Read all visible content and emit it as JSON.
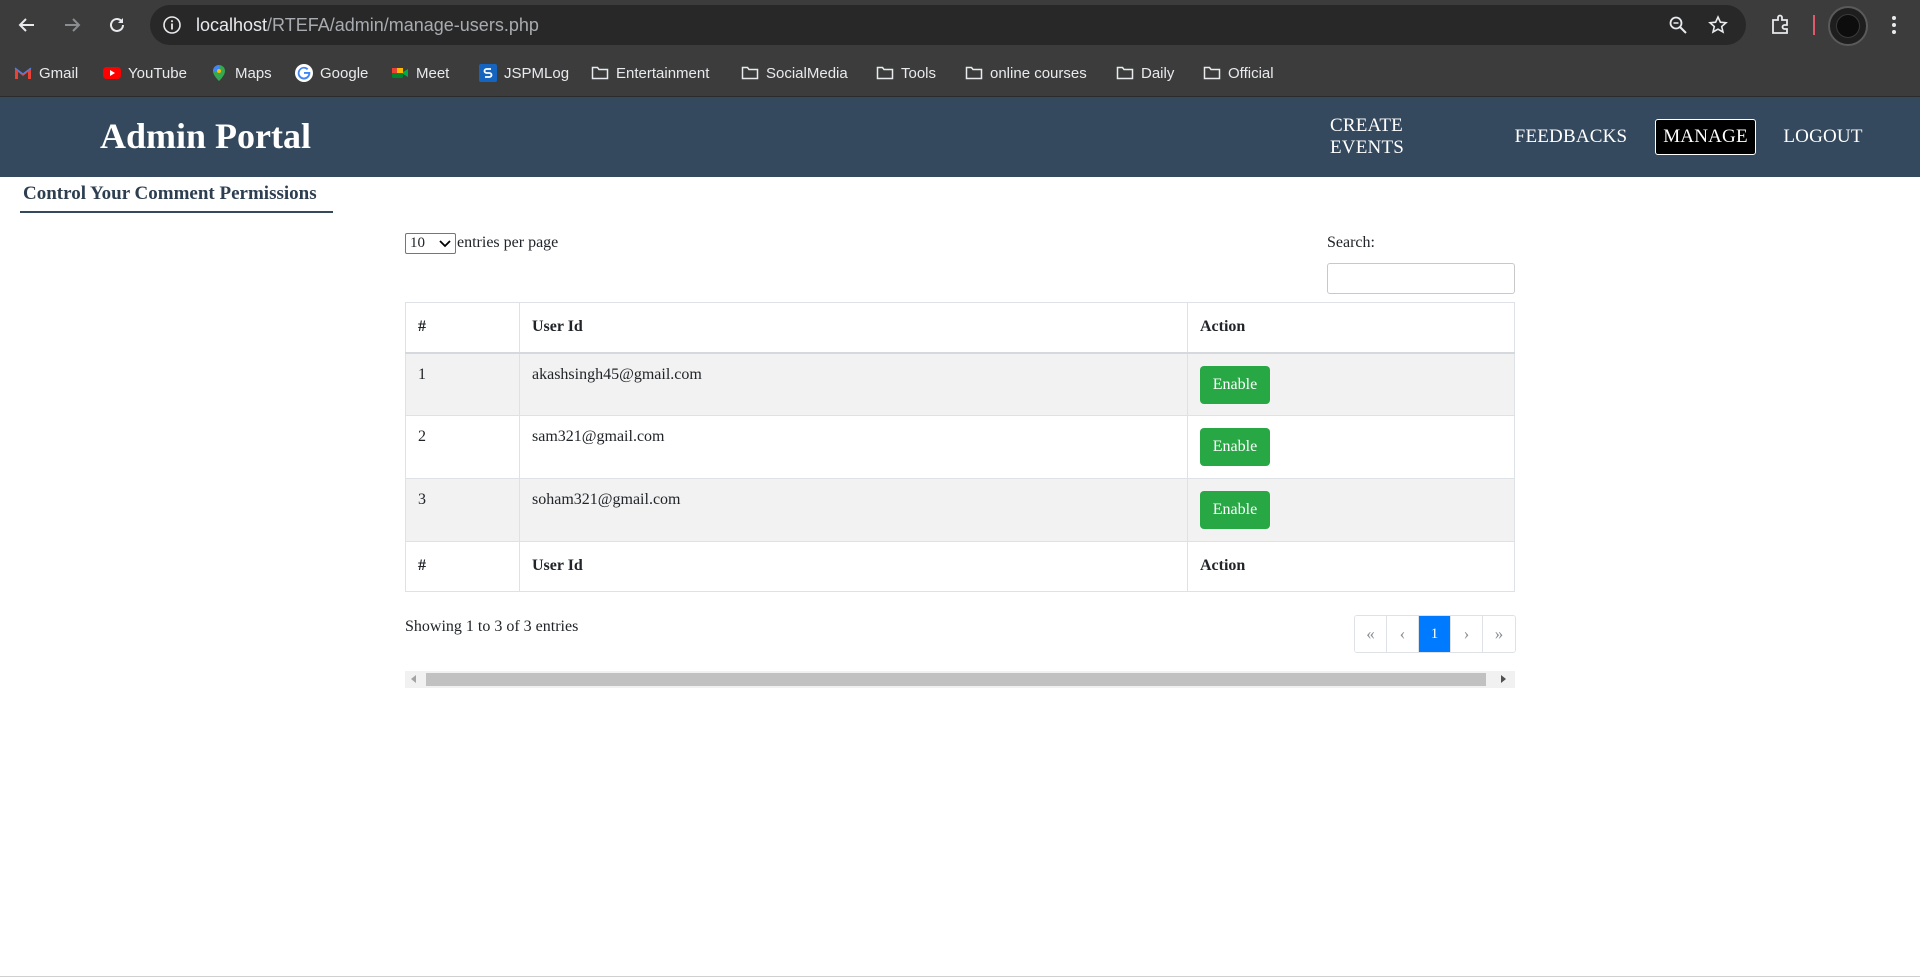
{
  "browser": {
    "url_host": "localhost",
    "url_path": "/RTEFA/admin/manage-users.php",
    "bookmarks": [
      {
        "label": "Gmail",
        "icon": "gmail-icon"
      },
      {
        "label": "YouTube",
        "icon": "youtube-icon"
      },
      {
        "label": "Maps",
        "icon": "maps-icon"
      },
      {
        "label": "Google",
        "icon": "google-icon"
      },
      {
        "label": "Meet",
        "icon": "meet-icon"
      },
      {
        "label": "JSPMLog",
        "icon": "jspm-icon"
      },
      {
        "label": "Entertainment",
        "icon": "folder-icon"
      },
      {
        "label": "SocialMedia",
        "icon": "folder-icon"
      },
      {
        "label": "Tools",
        "icon": "folder-icon"
      },
      {
        "label": "online courses",
        "icon": "folder-icon"
      },
      {
        "label": "Daily",
        "icon": "folder-icon"
      },
      {
        "label": "Official",
        "icon": "folder-icon"
      }
    ]
  },
  "header": {
    "brand": "Admin Portal",
    "menu": [
      "CREATE EVENTS",
      "FEEDBACKS",
      "MANAGE",
      "LOGOUT"
    ],
    "active_menu": "MANAGE",
    "bg_color": "#34495e"
  },
  "section_title": "Control Your Comment Permissions",
  "table": {
    "page_length": "10",
    "length_label": "entries per page",
    "search_label": "Search:",
    "search_value": "",
    "columns": [
      "#",
      "User Id",
      "Action"
    ],
    "rows": [
      {
        "num": "1",
        "user_id": "akashsingh45@gmail.com",
        "action": "Enable"
      },
      {
        "num": "2",
        "user_id": "sam321@gmail.com",
        "action": "Enable"
      },
      {
        "num": "3",
        "user_id": "soham321@gmail.com",
        "action": "Enable"
      }
    ],
    "info": "Showing 1 to 3 of 3 entries",
    "pagination": {
      "first": "«",
      "prev": "‹",
      "current": "1",
      "next": "›",
      "last": "»"
    },
    "button_color": "#28a745",
    "current_page_color": "#007bff"
  }
}
